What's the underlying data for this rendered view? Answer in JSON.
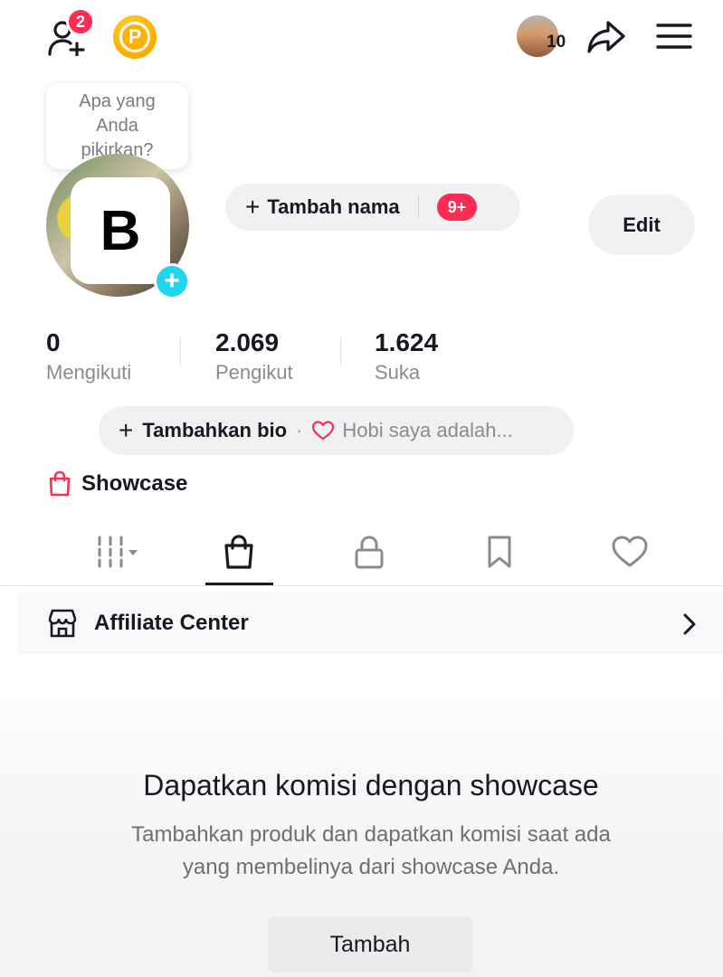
{
  "header": {
    "friends_badge": "2",
    "coin_letter": "P",
    "avatar_count": "10"
  },
  "tooltip": {
    "text": "Apa yang Anda pikirkan?"
  },
  "profile": {
    "avatar_letter": "B",
    "add_name_label": "Tambah nama",
    "notif_badge": "9+",
    "edit_label": "Edit"
  },
  "stats": [
    {
      "value": "0",
      "label": "Mengikuti"
    },
    {
      "value": "2.069",
      "label": "Pengikut"
    },
    {
      "value": "1.624",
      "label": "Suka"
    }
  ],
  "bio": {
    "add_label": "Tambahkan bio",
    "separator": "·",
    "hint": "Hobi saya adalah..."
  },
  "showcase": {
    "label": "Showcase"
  },
  "tabs": [
    {
      "icon": "grid-icon",
      "active": false
    },
    {
      "icon": "shopping-bag-icon",
      "active": true
    },
    {
      "icon": "lock-icon",
      "active": false
    },
    {
      "icon": "bookmark-icon",
      "active": false
    },
    {
      "icon": "heart-icon",
      "active": false
    }
  ],
  "affiliate": {
    "label": "Affiliate Center"
  },
  "empty_state": {
    "title": "Dapatkan komisi dengan showcase",
    "description_line1": "Tambahkan produk dan dapatkan komisi saat ada",
    "description_line2": "yang membelinya dari showcase Anda.",
    "button_label": "Tambah"
  },
  "colors": {
    "accent": "#fe2c55",
    "plus_badge": "#20d5ec",
    "coin": "#ffb300"
  }
}
